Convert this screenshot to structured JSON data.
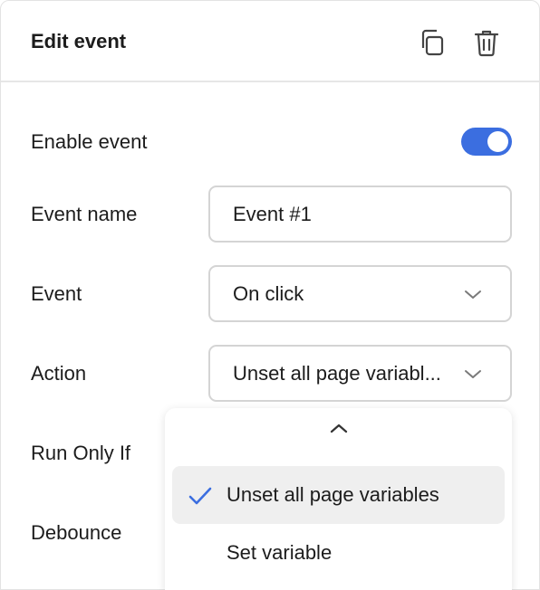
{
  "header": {
    "title": "Edit event",
    "copy_icon": "copy-icon",
    "delete_icon": "trash-icon"
  },
  "enable": {
    "label": "Enable event",
    "on": true
  },
  "event_name": {
    "label": "Event name",
    "value": "Event #1"
  },
  "event": {
    "label": "Event",
    "value": "On click"
  },
  "action": {
    "label": "Action",
    "value": "Unset all page variabl..."
  },
  "run_only_if": {
    "label": "Run Only If"
  },
  "debounce": {
    "label": "Debounce"
  },
  "menu": {
    "items": [
      {
        "label": "Unset all page variables",
        "selected": true
      },
      {
        "label": "Set variable",
        "selected": false
      }
    ]
  },
  "colors": {
    "accent": "#3b6ee0",
    "border": "#d4d4d4",
    "selected_bg": "#efefef"
  }
}
